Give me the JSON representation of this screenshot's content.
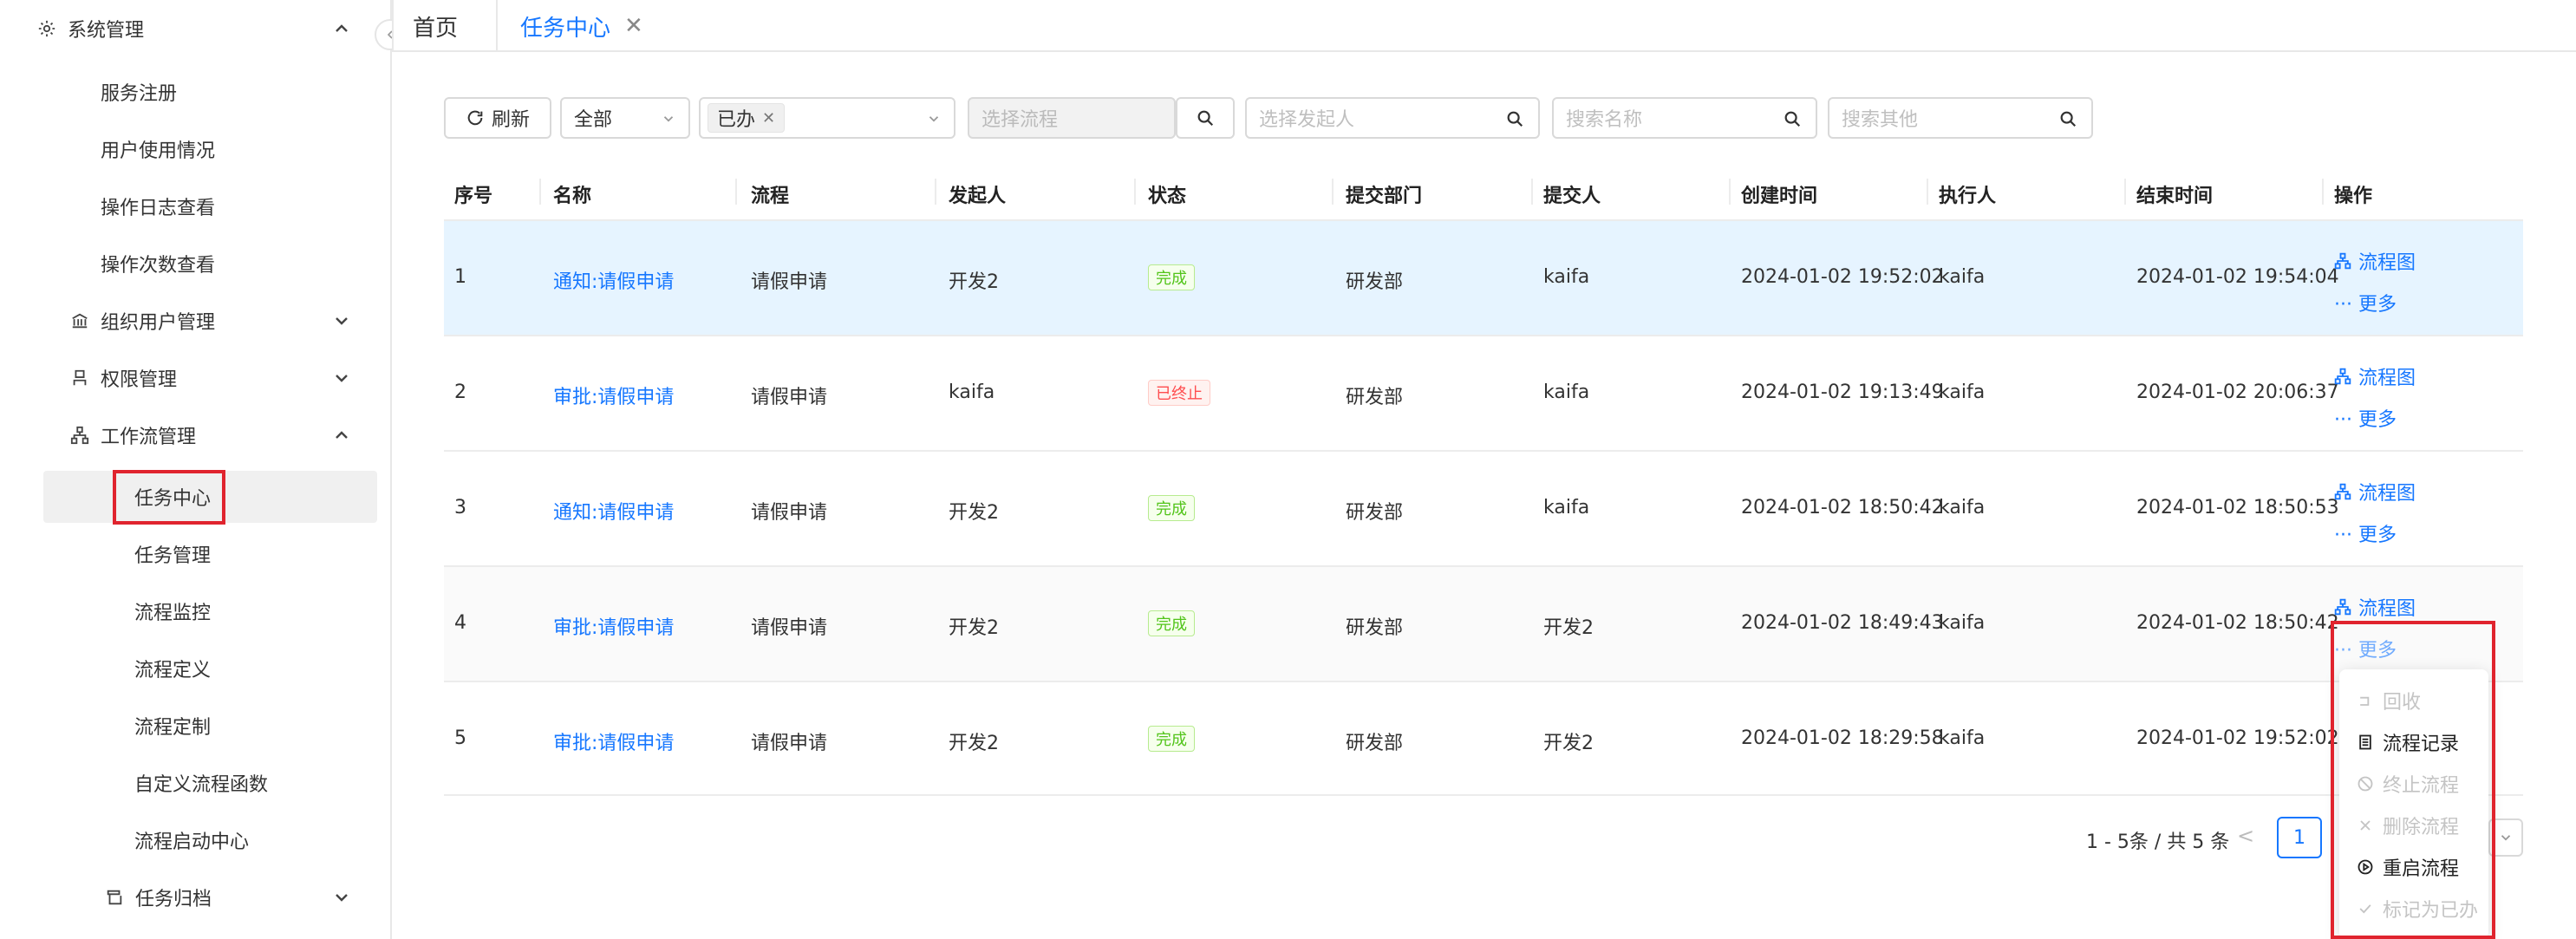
{
  "sidebar": {
    "group_system": "系统管理",
    "items_system": [
      "服务注册",
      "用户使用情况",
      "操作日志查看",
      "操作次数查看"
    ],
    "group_org": "组织用户管理",
    "group_perm": "权限管理",
    "group_workflow": "工作流管理",
    "items_workflow": [
      "任务中心",
      "任务管理",
      "流程监控",
      "流程定义",
      "流程定制",
      "自定义流程函数",
      "流程启动中心"
    ],
    "group_archive": "任务归档",
    "active_item": "任务中心"
  },
  "tabs": {
    "home": "首页",
    "active": "任务中心"
  },
  "toolbar": {
    "refresh": "刷新",
    "scope_select": "全部",
    "status_tag": "已办",
    "process_placeholder": "选择流程",
    "initiator_placeholder": "选择发起人",
    "name_placeholder": "搜索名称",
    "other_placeholder": "搜索其他"
  },
  "table": {
    "headers": [
      "序号",
      "名称",
      "流程",
      "发起人",
      "状态",
      "提交部门",
      "提交人",
      "创建时间",
      "执行人",
      "结束时间",
      "操作"
    ],
    "rows": [
      {
        "no": "1",
        "name": "通知:请假申请",
        "process": "请假申请",
        "initiator": "开发2",
        "status": "完成",
        "dept": "研发部",
        "submitter": "kaifa",
        "created": "2024-01-02 19:52:02",
        "executor": "kaifa",
        "ended": "2024-01-02 19:54:04"
      },
      {
        "no": "2",
        "name": "审批:请假申请",
        "process": "请假申请",
        "initiator": "kaifa",
        "status": "已终止",
        "dept": "研发部",
        "submitter": "kaifa",
        "created": "2024-01-02 19:13:49",
        "executor": "kaifa",
        "ended": "2024-01-02 20:06:37"
      },
      {
        "no": "3",
        "name": "通知:请假申请",
        "process": "请假申请",
        "initiator": "开发2",
        "status": "完成",
        "dept": "研发部",
        "submitter": "kaifa",
        "created": "2024-01-02 18:50:42",
        "executor": "kaifa",
        "ended": "2024-01-02 18:50:53"
      },
      {
        "no": "4",
        "name": "审批:请假申请",
        "process": "请假申请",
        "initiator": "开发2",
        "status": "完成",
        "dept": "研发部",
        "submitter": "开发2",
        "created": "2024-01-02 18:49:43",
        "executor": "kaifa",
        "ended": "2024-01-02 18:50:42"
      },
      {
        "no": "5",
        "name": "审批:请假申请",
        "process": "请假申请",
        "initiator": "开发2",
        "status": "完成",
        "dept": "研发部",
        "submitter": "开发2",
        "created": "2024-01-02 18:29:58",
        "executor": "kaifa",
        "ended": "2024-01-02 19:52:02"
      }
    ],
    "op_flow": "流程图",
    "op_more": "··· 更多"
  },
  "pagination": {
    "total": "1 - 5条 / 共 5 条",
    "prev": "<",
    "current": "1"
  },
  "menu": {
    "items": [
      "回收",
      "流程记录",
      "终止流程",
      "删除流程",
      "重启流程",
      "标记为已办"
    ]
  }
}
